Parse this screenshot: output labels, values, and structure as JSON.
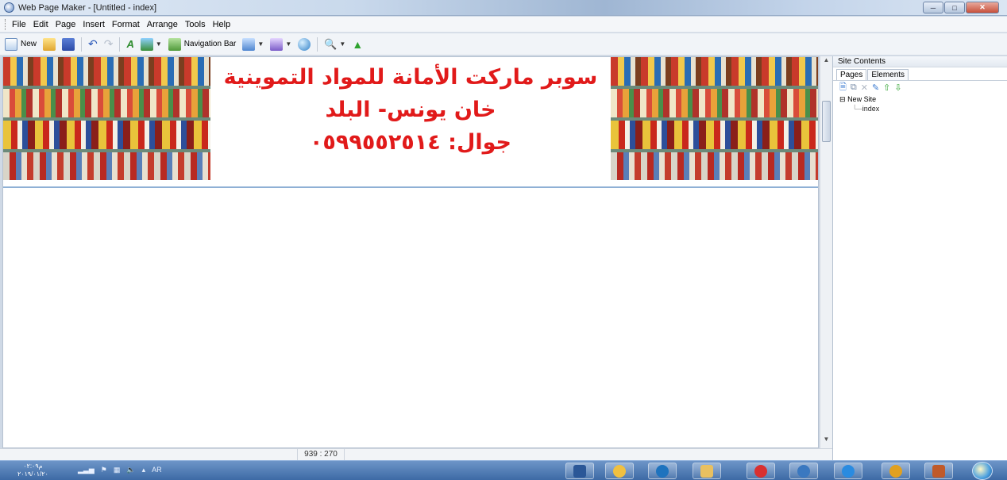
{
  "window": {
    "title": "Web Page Maker - [Untitled - index]",
    "controls": [
      "minimize",
      "maximize",
      "close"
    ]
  },
  "menu": {
    "items": [
      "File",
      "Edit",
      "Page",
      "Insert",
      "Format",
      "Arrange",
      "Tools",
      "Help"
    ]
  },
  "toolbar": {
    "new_label": "New",
    "navbar_label": "Navigation Bar"
  },
  "banner": {
    "line1": "سوبر ماركت الأمانة للمواد التموينية",
    "line2": "خان يونس- البلد",
    "line3": "جوال: ٠٥٩٩٥٥٢٥١٤"
  },
  "status": {
    "coords": "939 : 270"
  },
  "site_panel": {
    "header": "Site Contents",
    "tabs": [
      "Pages",
      "Elements"
    ],
    "tree": {
      "root": "New Site",
      "children": [
        "index"
      ]
    }
  },
  "taskbar": {
    "time": "م٠٢:٠٩",
    "date": "٢٠١٩/٠١/٢٠",
    "lang": "AR",
    "apps": [
      "word",
      "paint",
      "browser-target",
      "explorer",
      "app-red",
      "cd-player",
      "internet-explorer",
      "chrome",
      "media"
    ],
    "colors": {
      "word": "#2b5797",
      "paint": "#f0c040",
      "browser-target": "#1e73be",
      "explorer": "#e8c060",
      "app-red": "#d83030",
      "cd-player": "#3a78c0",
      "internet-explorer": "#2a8be0",
      "chrome": "#e0a020",
      "media": "#c05a2a"
    }
  },
  "banner_colors": {
    "text": "#e11a1a",
    "rule": "#8fb0d5"
  }
}
